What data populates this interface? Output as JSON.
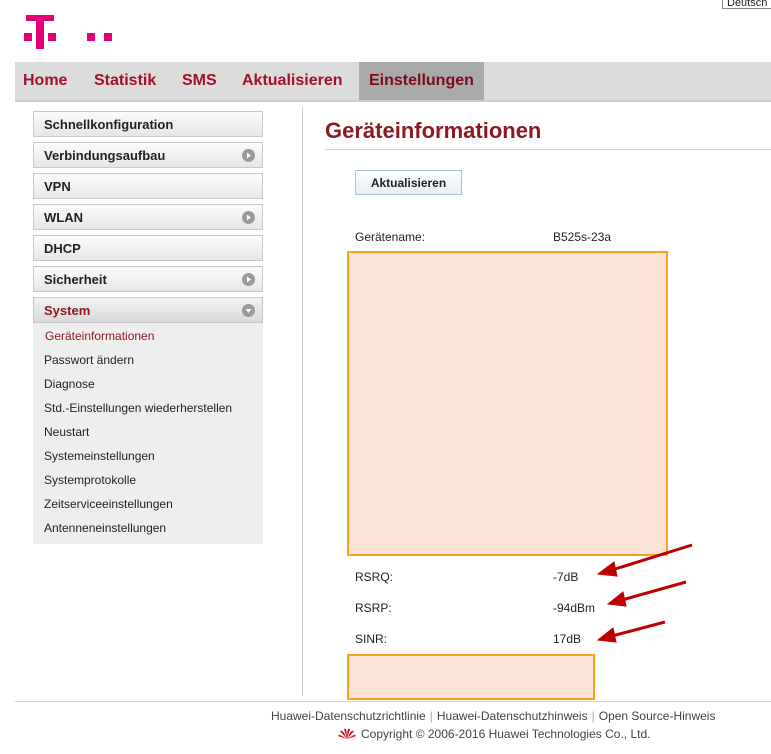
{
  "header": {
    "language": "Deutsch",
    "logo_color": "#e20074"
  },
  "nav": {
    "items": [
      {
        "label": "Home"
      },
      {
        "label": "Statistik"
      },
      {
        "label": "SMS"
      },
      {
        "label": "Aktualisieren"
      },
      {
        "label": "Einstellungen",
        "active": true
      }
    ]
  },
  "sidebar": {
    "items": [
      {
        "label": "Schnellkonfiguration",
        "expandable": false
      },
      {
        "label": "Verbindungsaufbau",
        "expandable": true
      },
      {
        "label": "VPN",
        "expandable": false
      },
      {
        "label": "WLAN",
        "expandable": true
      },
      {
        "label": "DHCP",
        "expandable": false
      },
      {
        "label": "Sicherheit",
        "expandable": true
      },
      {
        "label": "System",
        "expandable": true,
        "expanded": true
      }
    ],
    "system_submenu": [
      {
        "label": "Geräteinformationen",
        "active": true
      },
      {
        "label": "Passwort ändern"
      },
      {
        "label": "Diagnose"
      },
      {
        "label": "Std.-Einstellungen wiederherstellen"
      },
      {
        "label": "Neustart"
      },
      {
        "label": "Systemeinstellungen"
      },
      {
        "label": "Systemprotokolle"
      },
      {
        "label": "Zeitserviceeinstellungen"
      },
      {
        "label": "Antenneneinstellungen"
      }
    ]
  },
  "main": {
    "title": "Geräteinformationen",
    "refresh_label": "Aktualisieren",
    "device_name_label": "Gerätename:",
    "device_name_value": "B525s-23a",
    "rsrq_label": "RSRQ:",
    "rsrq_value": "-7dB",
    "rsrp_label": "RSRP:",
    "rsrp_value": "-94dBm",
    "sinr_label": "SINR:",
    "sinr_value": "17dB"
  },
  "footer": {
    "link1": "Huawei-Datenschutzrichtlinie",
    "link2": "Huawei-Datenschutzhinweis",
    "link3": "Open Source-Hinweis",
    "copyright": "Copyright © 2006-2016 Huawei Technologies Co., Ltd."
  },
  "colors": {
    "brand": "#e20074",
    "accent": "#8c1a22",
    "annotation_arrow": "#c00000",
    "redaction_fill": "#fbe4d6",
    "redaction_border": "#f7a21b"
  }
}
